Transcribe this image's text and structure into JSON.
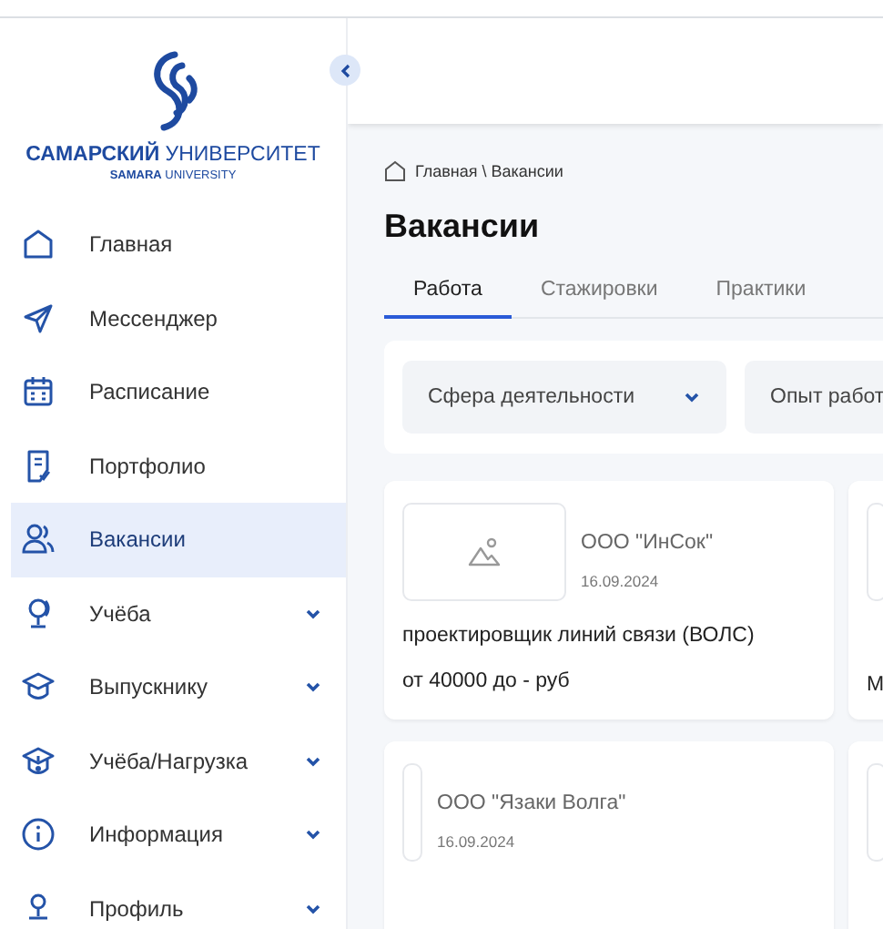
{
  "sidebar": {
    "logo": {
      "title": "**САМАРСКИЙ** УНИВЕРСИТЕТ",
      "subtitle": "**SAMARA** UNIVERSITY"
    },
    "items": [
      {
        "label": "Главная",
        "selected": false,
        "has_submenu": false
      },
      {
        "label": "Мессенджер",
        "selected": false,
        "has_submenu": false
      },
      {
        "label": "Расписание",
        "selected": false,
        "has_submenu": false
      },
      {
        "label": "Портфолио",
        "selected": false,
        "has_submenu": false
      },
      {
        "label": "Вакансии",
        "selected": true,
        "has_submenu": false
      },
      {
        "label": "Учёба",
        "selected": false,
        "has_submenu": true
      },
      {
        "label": "Выпускнику",
        "selected": false,
        "has_submenu": true
      },
      {
        "label": "Учёба/Нагрузка",
        "selected": false,
        "has_submenu": true
      },
      {
        "label": "Информация",
        "selected": false,
        "has_submenu": true
      },
      {
        "label": "Профиль",
        "selected": false,
        "has_submenu": true
      }
    ]
  },
  "main": {
    "breadcrumb": "Главная \\ Вакансии",
    "title": "Вакансии",
    "tabs": [
      {
        "label": "Работа",
        "selected": true
      },
      {
        "label": "Стажировки",
        "selected": false
      },
      {
        "label": "Практики",
        "selected": false
      }
    ],
    "filters": [
      {
        "label": "Сфера деятельности",
        "kind": "dropdown"
      },
      {
        "label": "Опыт работ",
        "kind": "text"
      }
    ],
    "cards": [
      {
        "logo_icon": true,
        "company": "ООО \"ИнСок\"",
        "date": "16.09.2024",
        "title": "проектировщик линий связи (ВОЛС)",
        "salary": "от 40000 до - руб"
      },
      {
        "logo_icon": false,
        "salary": "М"
      },
      {
        "logo_icon": false,
        "company": "ООО \"Язаки Волга\"",
        "date": "16.09.2024"
      },
      {
        "logo_icon": false
      }
    ]
  }
}
